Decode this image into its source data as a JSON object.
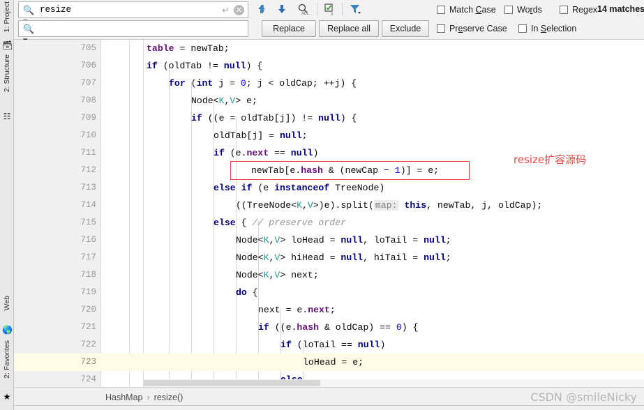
{
  "left_strip": {
    "tabs": [
      {
        "label": "1: Project",
        "icon": "project-icon"
      },
      {
        "label": "2: Structure",
        "icon": "structure-icon"
      },
      {
        "label": "Web",
        "icon": "web-globe-icon"
      },
      {
        "label": "2: Favorites",
        "icon": "favorites-star-icon"
      }
    ]
  },
  "find": {
    "search_value": "resize",
    "search_placeholder": "",
    "replace_value": "",
    "replace_placeholder": "",
    "magnifier_icon": "search-icon",
    "enter_icon": "enter-arrow-icon",
    "clear_icon": "clear-circle-icon",
    "toolbar_icons": [
      {
        "name": "find-previous-icon",
        "glyph": "↑"
      },
      {
        "name": "find-next-icon",
        "glyph": "↓"
      },
      {
        "name": "find-all-icon",
        "glyph": "⌕"
      },
      {
        "name": "select-all-occurrences-icon",
        "glyph": "☑"
      },
      {
        "name": "filter-icon",
        "glyph": "▼"
      }
    ],
    "buttons": {
      "replace": "Replace",
      "replace_all": "Replace all",
      "exclude": "Exclude"
    },
    "checkboxes": [
      {
        "name": "match-case",
        "label_pre": "Match ",
        "label_u": "C",
        "label_post": "ase",
        "checked": false
      },
      {
        "name": "words",
        "label_pre": "Wo",
        "label_u": "r",
        "label_post": "ds",
        "checked": false
      },
      {
        "name": "regex",
        "label_pre": "Re",
        "label_u": "g",
        "label_post": "ex",
        "checked": false
      },
      {
        "name": "preserve-case",
        "label_pre": "Pr",
        "label_u": "e",
        "label_post": "serve Case",
        "checked": false
      },
      {
        "name": "in-selection",
        "label_pre": "In ",
        "label_u": "S",
        "label_post": "election",
        "checked": false
      }
    ],
    "matches_count": "14 matches"
  },
  "editor": {
    "first_line": 705,
    "highlighted_line": 723,
    "lines": [
      {
        "n": "705",
        "indent": 8
      },
      {
        "n": "706",
        "indent": 8
      },
      {
        "n": "707",
        "indent": 12
      },
      {
        "n": "708",
        "indent": 16
      },
      {
        "n": "709",
        "indent": 16
      },
      {
        "n": "710",
        "indent": 20
      },
      {
        "n": "711",
        "indent": 20
      },
      {
        "n": "712",
        "indent": 24
      },
      {
        "n": "713",
        "indent": 20
      },
      {
        "n": "714",
        "indent": 24
      },
      {
        "n": "715",
        "indent": 20
      },
      {
        "n": "716",
        "indent": 24
      },
      {
        "n": "717",
        "indent": 24
      },
      {
        "n": "718",
        "indent": 24
      },
      {
        "n": "719",
        "indent": 24
      },
      {
        "n": "720",
        "indent": 28
      },
      {
        "n": "721",
        "indent": 28
      },
      {
        "n": "722",
        "indent": 32
      },
      {
        "n": "723",
        "indent": 36
      },
      {
        "n": "724",
        "indent": 32
      }
    ],
    "code_text": [
      "table = newTab;",
      "if (oldTab != null) {",
      "for (int j = 0; j < oldCap; ++j) {",
      "Node<K,V> e;",
      "if ((e = oldTab[j]) != null) {",
      "oldTab[j] = null;",
      "if (e.next == null)",
      "newTab[e.hash & (newCap - 1)] = e;",
      "else if (e instanceof TreeNode)",
      "((TreeNode<K,V>)e).split( map: this, newTab, j, oldCap);",
      "else { // preserve order",
      "Node<K,V> loHead = null, loTail = null;",
      "Node<K,V> hiHead = null, hiTail = null;",
      "Node<K,V> next;",
      "do {",
      "next = e.next;",
      "if ((e.hash & oldCap) == 0) {",
      "if (loTail == null)",
      "loHead = e;",
      "else"
    ],
    "annotation": "resize扩容源码",
    "annotation_color": "#f04a44",
    "highlight_box_color": "#e8403a"
  },
  "status": {
    "breadcrumb_class": "HashMap",
    "breadcrumb_sep": "›",
    "breadcrumb_method": "resize()",
    "watermark": "CSDN @smileNicky"
  }
}
